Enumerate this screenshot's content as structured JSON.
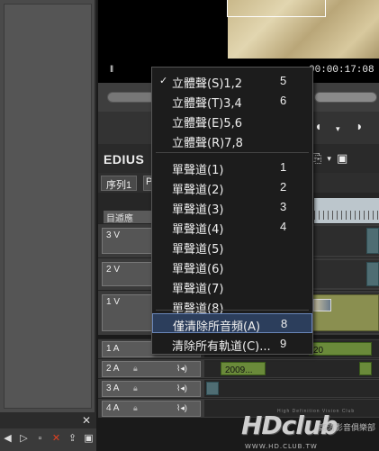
{
  "preview": {
    "timecode": "00:00:17:08",
    "marker": "‖"
  },
  "edius": {
    "label": "EDIUS",
    "seq_tab": "序列1",
    "seq_tab2": "P",
    "ruler_left": "目遁應",
    "ruler_marker": "0"
  },
  "tracks": {
    "v3": "3 V",
    "v2": "2 V",
    "v1": "1 V",
    "a1": "1 A",
    "a2": "2 A",
    "a3": "3 A",
    "a4": "4 A",
    "clip_a1": "20",
    "clip_a2": "2009..."
  },
  "menu": {
    "items": [
      {
        "label": "立體聲(S)1,2",
        "shortcut": "5",
        "checked": true
      },
      {
        "label": "立體聲(T)3,4",
        "shortcut": "6",
        "checked": false
      },
      {
        "label": "立體聲(E)5,6",
        "shortcut": "",
        "checked": false
      },
      {
        "label": "立體聲(R)7,8",
        "shortcut": "",
        "checked": false
      },
      {
        "label": "單聲道(1)",
        "shortcut": "1",
        "checked": false
      },
      {
        "label": "單聲道(2)",
        "shortcut": "2",
        "checked": false
      },
      {
        "label": "單聲道(3)",
        "shortcut": "3",
        "checked": false
      },
      {
        "label": "單聲道(4)",
        "shortcut": "4",
        "checked": false
      },
      {
        "label": "單聲道(5)",
        "shortcut": "",
        "checked": false
      },
      {
        "label": "單聲道(6)",
        "shortcut": "",
        "checked": false
      },
      {
        "label": "單聲道(7)",
        "shortcut": "",
        "checked": false
      },
      {
        "label": "單聲道(8)",
        "shortcut": "",
        "checked": false
      },
      {
        "label": "僅清除所音頻(A)",
        "shortcut": "8",
        "checked": false
      },
      {
        "label": "清除所有軌道(C)...",
        "shortcut": "9",
        "checked": false
      }
    ],
    "check_glyph": "✓"
  },
  "watermark": {
    "logo": "HDclub",
    "chinese": "高清影音俱樂部",
    "url": "WWW.HD.CLUB.TW",
    "tagline": "High Definition Vision Club"
  },
  "left_panel": {
    "close": "✕"
  }
}
